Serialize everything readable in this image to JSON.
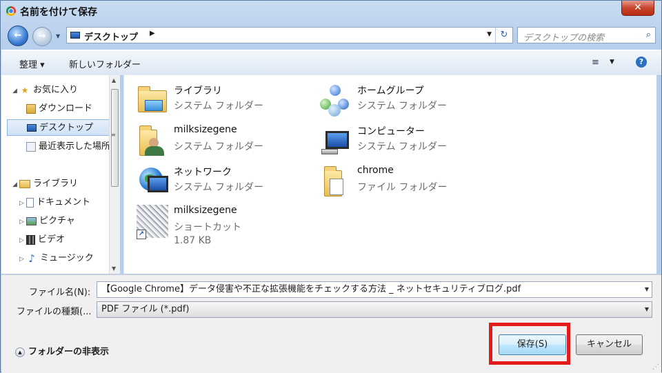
{
  "window": {
    "title": "名前を付けて保存",
    "close_label": "✕"
  },
  "nav": {
    "breadcrumb": "デスクトップ",
    "search_placeholder": "デスクトップの検索"
  },
  "toolbar": {
    "organize_label": "整理 ▾",
    "new_folder_label": "新しいフォルダー"
  },
  "sidebar": {
    "items": [
      {
        "label": "お気に入り",
        "icon": "star-icon"
      },
      {
        "label": "ダウンロード",
        "icon": "downloads-icon"
      },
      {
        "label": "デスクトップ",
        "icon": "desktop-icon",
        "selected": true
      },
      {
        "label": "最近表示した場所",
        "icon": "recent-places-icon"
      },
      {
        "label": "ライブラリ",
        "icon": "library-icon"
      },
      {
        "label": "ドキュメント",
        "icon": "documents-icon"
      },
      {
        "label": "ピクチャ",
        "icon": "pictures-icon"
      },
      {
        "label": "ビデオ",
        "icon": "videos-icon"
      },
      {
        "label": "ミュージック",
        "icon": "music-icon"
      }
    ]
  },
  "files": [
    {
      "name": "ライブラリ",
      "type": "システム フォルダー",
      "icon": "library-folder-icon"
    },
    {
      "name": "ホームグループ",
      "type": "システム フォルダー",
      "icon": "homegroup-icon"
    },
    {
      "name": "milksizegene",
      "type": "システム フォルダー",
      "icon": "user-folder-icon"
    },
    {
      "name": "コンピューター",
      "type": "システム フォルダー",
      "icon": "computer-icon"
    },
    {
      "name": "ネットワーク",
      "type": "システム フォルダー",
      "icon": "network-icon"
    },
    {
      "name": "chrome",
      "type": "ファイル フォルダー",
      "icon": "folder-icon"
    },
    {
      "name": "milksizegene",
      "type": "ショートカット",
      "size": "1.87 KB",
      "icon": "shortcut-icon"
    }
  ],
  "form": {
    "filename_label": "ファイル名(N):",
    "filename_value": "【Google Chrome】データ侵害や不正な拡張機能をチェックする方法 _ ネットセキュリティブログ.pdf",
    "filetype_label": "ファイルの種類(...",
    "filetype_value": "PDF ファイル (*.pdf)"
  },
  "footer": {
    "hide_folders_label": "フォルダーの非表示",
    "save_label": "保存(S)",
    "cancel_label": "キャンセル"
  },
  "colors": {
    "highlight": "#e21a1a",
    "selection": "#cfe1f7"
  }
}
